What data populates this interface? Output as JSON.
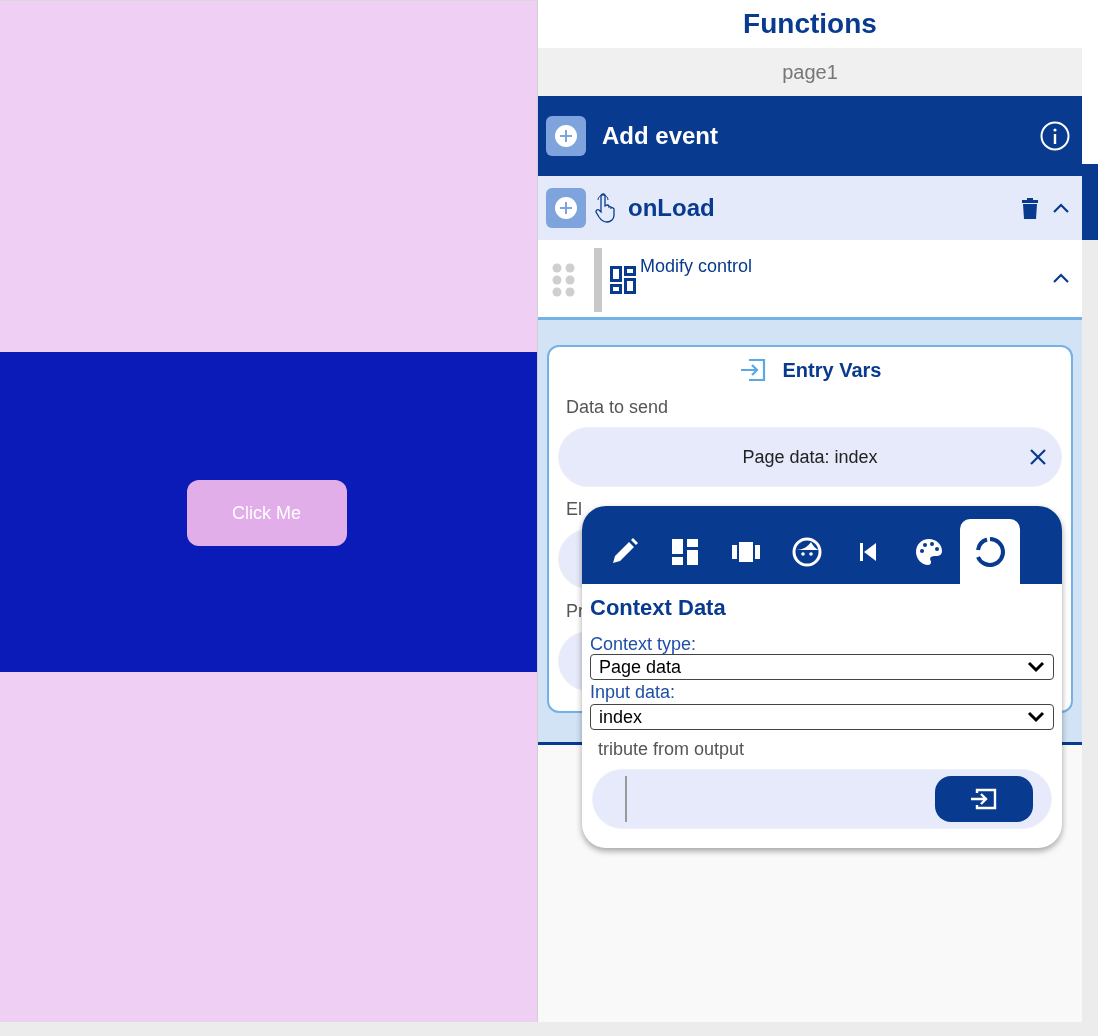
{
  "canvas": {
    "button": {
      "label": "Click Me"
    }
  },
  "panel": {
    "title": "Functions",
    "page": "page1",
    "add_event": {
      "label": "Add event"
    },
    "event": {
      "name": "onLoad",
      "expanded": true
    },
    "action": {
      "label": "Modify control",
      "expanded": true
    },
    "entry_vars": {
      "title": "Entry Vars",
      "fields": [
        {
          "label": "Data to send",
          "value": "Page data: index"
        },
        {
          "label": "El"
        },
        {
          "label": "Pr"
        }
      ]
    },
    "popup": {
      "tabs": [
        {
          "selected": false
        },
        {
          "selected": false
        },
        {
          "selected": false
        },
        {
          "selected": false
        },
        {
          "selected": false
        },
        {
          "selected": false
        },
        {
          "selected": true
        }
      ],
      "title": "Context Data",
      "context_type": {
        "label": "Context type:",
        "value": "Page data"
      },
      "input_data": {
        "label": "Input data:",
        "value": "index"
      },
      "attribute": {
        "label": "tribute from output"
      }
    }
  }
}
